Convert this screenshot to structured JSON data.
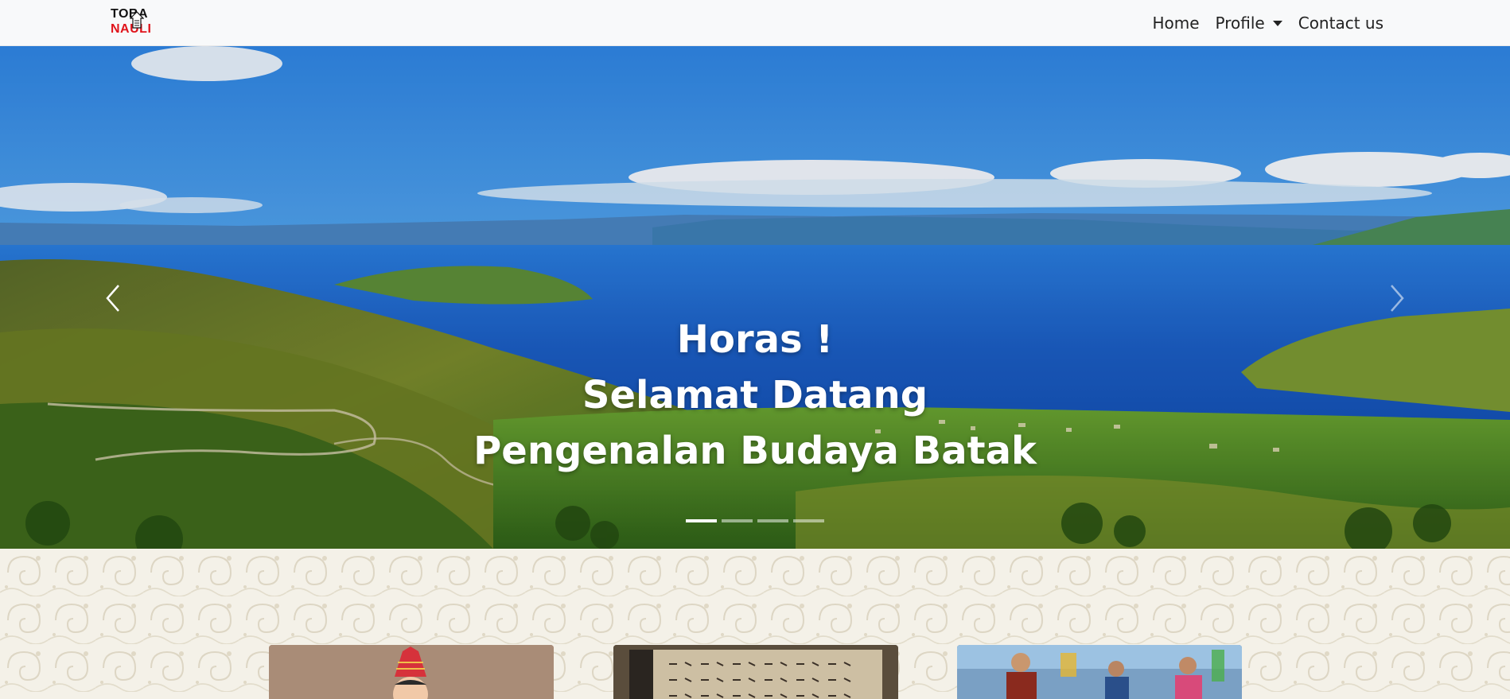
{
  "navbar": {
    "brand": {
      "line1": "TOBA",
      "line2": "NAULI"
    },
    "links": [
      {
        "label": "Home"
      },
      {
        "label": "Profile"
      },
      {
        "label": "Contact us"
      }
    ]
  },
  "hero": {
    "caption": {
      "line1": "Horas !",
      "line2": "Selamat Datang",
      "line3": "Pengenalan Budaya Batak"
    },
    "slides_count": 4,
    "active_slide": 1,
    "prev_icon": "chevron-left-icon",
    "next_icon": "chevron-right-icon"
  },
  "colors": {
    "navbar_bg": "#f8f9fa",
    "brand_red": "#e0141b",
    "pattern_bg": "#f4f1e8"
  }
}
